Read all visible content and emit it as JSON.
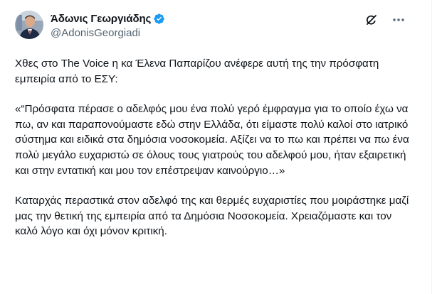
{
  "author": {
    "display_name": "Άδωνις Γεωργιάδης",
    "handle": "@AdonisGeorgiadi"
  },
  "colors": {
    "text": "#0f1419",
    "secondary": "#536471",
    "verified": "#1d9bf0",
    "link": "#1d9bf0"
  },
  "icons": {
    "top_right": [
      "grok-icon",
      "more-icon"
    ]
  },
  "tweet": {
    "paragraphs": [
      "Χθες στο The Voice η κα Έλενα Παπαρίζου ανέφερε αυτή της την πρόσφατη εμπειρία από το ΕΣΥ:",
      "«“Πρόσφατα πέρασε ο αδελφός μου ένα πολύ γερό έμφραγμα για το οποίο έχω να πω, αν και παραπονούμαστε εδώ στην Ελλάδα, ότι είμαστε πολύ καλοί στο ιατρικό σύστημα και ειδικά στα δημόσια νοσοκομεία. Αξίζει να το πω και πρέπει να πω ένα πολύ μεγάλο ευχαριστώ σε όλους τους γιατρούς του αδελφού μου, ήταν εξαιρετική και στην εντατική και μου τον επέστρεψαν καινούργιο…»",
      "Καταρχάς περαστικά στον αδελφό της και θερμές ευχαριστίες που μοιράστηκε μαζί μας την θετική της εμπειρία από τα Δημόσια Νοσοκομεία. Χρειαζόμαστε και τον καλό λόγο και όχι μόνον κριτική."
    ]
  }
}
